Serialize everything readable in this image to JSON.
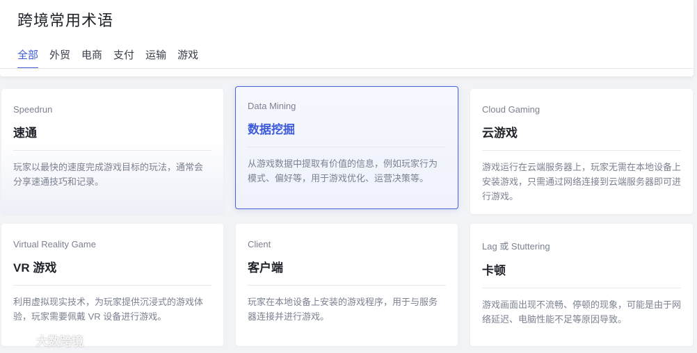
{
  "header": {
    "title": "跨境常用术语"
  },
  "tabs": [
    {
      "label": "全部"
    },
    {
      "label": "外贸"
    },
    {
      "label": "电商"
    },
    {
      "label": "支付"
    },
    {
      "label": "运输"
    },
    {
      "label": "游戏"
    }
  ],
  "active_tab": "全部",
  "cards": [
    {
      "en": "Speedrun",
      "zh": "速通",
      "desc": "玩家以最快的速度完成游戏目标的玩法，通常会分享速通技巧和记录。"
    },
    {
      "en": "Data Mining",
      "zh": "数据挖掘",
      "desc": "从游戏数据中提取有价值的信息，例如玩家行为模式、偏好等，用于游戏优化、运营决策等。"
    },
    {
      "en": "Cloud Gaming",
      "zh": "云游戏",
      "desc": "游戏运行在云端服务器上，玩家无需在本地设备上安装游戏，只需通过网络连接到云端服务器即可进行游戏。"
    },
    {
      "en": "Virtual Reality Game",
      "zh": "VR 游戏",
      "desc": "利用虚拟现实技术，为玩家提供沉浸式的游戏体验，玩家需要佩戴 VR 设备进行游戏。"
    },
    {
      "en": "Client",
      "zh": "客户端",
      "desc": "玩家在本地设备上安装的游戏程序，用于与服务器连接并进行游戏。"
    },
    {
      "en": "Lag 或 Stuttering",
      "zh": "卡顿",
      "desc": "游戏画面出现不流畅、停顿的现象，可能是由于网络延迟、电脑性能不足等原因导致。"
    }
  ],
  "watermark": {
    "text": "大数跨境"
  },
  "colors": {
    "accent": "#3d5bd9",
    "background": "#f2f3f6"
  }
}
